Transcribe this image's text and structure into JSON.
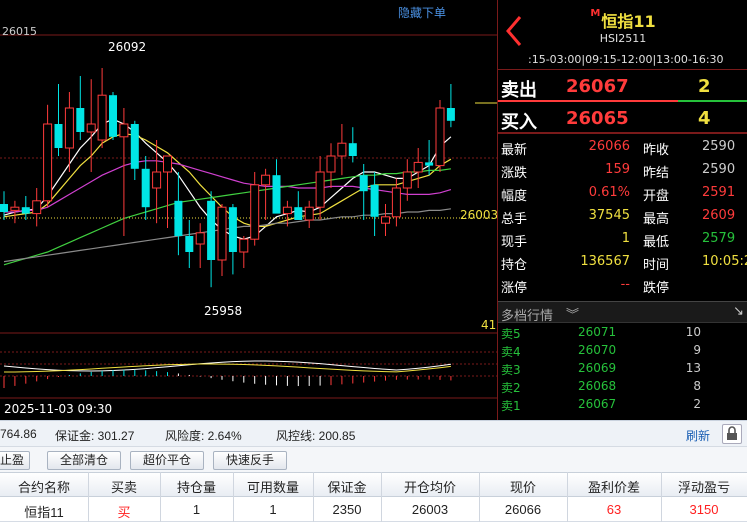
{
  "chart": {
    "hide_orders_label": "隐藏下单",
    "top_left_price": "26015",
    "high_label": "26092",
    "low_label": "25958",
    "current_price_tag": "26003",
    "volume_axis_value": "41",
    "date_label": "2025-11-03 09:30",
    "colors": {
      "up": "#ff3b3b",
      "down": "#00e5e5",
      "ma_white": "#ffffff",
      "ma_yellow": "#f0e040",
      "ma_purple": "#d040d0",
      "ma_green": "#40d040",
      "grid": "#7a1a1a"
    }
  },
  "chart_data": {
    "type": "candlestick",
    "y_range": [
      25940,
      26110
    ],
    "candles": [
      {
        "o": 26010,
        "h": 26018,
        "l": 26000,
        "c": 26005
      },
      {
        "o": 26006,
        "h": 26012,
        "l": 25998,
        "c": 26008
      },
      {
        "o": 26008,
        "h": 26015,
        "l": 26000,
        "c": 26004
      },
      {
        "o": 26004,
        "h": 26020,
        "l": 25996,
        "c": 26012
      },
      {
        "o": 26012,
        "h": 26072,
        "l": 26008,
        "c": 26060
      },
      {
        "o": 26060,
        "h": 26085,
        "l": 26040,
        "c": 26045
      },
      {
        "o": 26045,
        "h": 26080,
        "l": 26030,
        "c": 26070
      },
      {
        "o": 26070,
        "h": 26090,
        "l": 26050,
        "c": 26055
      },
      {
        "o": 26055,
        "h": 26088,
        "l": 26030,
        "c": 26060
      },
      {
        "o": 26050,
        "h": 26095,
        "l": 26045,
        "c": 26078
      },
      {
        "o": 26078,
        "h": 26080,
        "l": 26050,
        "c": 26052
      },
      {
        "o": 26052,
        "h": 26070,
        "l": 25990,
        "c": 26060
      },
      {
        "o": 26060,
        "h": 26062,
        "l": 26025,
        "c": 26032
      },
      {
        "o": 26032,
        "h": 26040,
        "l": 26000,
        "c": 26008
      },
      {
        "o": 26020,
        "h": 26050,
        "l": 25998,
        "c": 26030
      },
      {
        "o": 26030,
        "h": 26040,
        "l": 25995,
        "c": 26040
      },
      {
        "o": 26012,
        "h": 26030,
        "l": 25978,
        "c": 25990
      },
      {
        "o": 25990,
        "h": 26000,
        "l": 25970,
        "c": 25980
      },
      {
        "o": 25985,
        "h": 25998,
        "l": 25970,
        "c": 25992
      },
      {
        "o": 26012,
        "h": 26018,
        "l": 25958,
        "c": 25975
      },
      {
        "o": 25975,
        "h": 26010,
        "l": 25965,
        "c": 26008
      },
      {
        "o": 26008,
        "h": 26010,
        "l": 25966,
        "c": 25980
      },
      {
        "o": 25980,
        "h": 25990,
        "l": 25970,
        "c": 25988
      },
      {
        "o": 25988,
        "h": 26030,
        "l": 25984,
        "c": 26022
      },
      {
        "o": 26022,
        "h": 26032,
        "l": 26000,
        "c": 26028
      },
      {
        "o": 26028,
        "h": 26038,
        "l": 26018,
        "c": 26004
      },
      {
        "o": 26004,
        "h": 26012,
        "l": 25996,
        "c": 26008
      },
      {
        "o": 26008,
        "h": 26018,
        "l": 26002,
        "c": 26000
      },
      {
        "o": 26000,
        "h": 26012,
        "l": 25995,
        "c": 26008
      },
      {
        "o": 26008,
        "h": 26040,
        "l": 26000,
        "c": 26030
      },
      {
        "o": 26030,
        "h": 26048,
        "l": 26020,
        "c": 26040
      },
      {
        "o": 26040,
        "h": 26060,
        "l": 26028,
        "c": 26048
      },
      {
        "o": 26048,
        "h": 26058,
        "l": 26036,
        "c": 26040
      },
      {
        "o": 26028,
        "h": 26035,
        "l": 26000,
        "c": 26018
      },
      {
        "o": 26022,
        "h": 26030,
        "l": 25990,
        "c": 26002
      },
      {
        "o": 25998,
        "h": 26010,
        "l": 25990,
        "c": 26002
      },
      {
        "o": 26002,
        "h": 26026,
        "l": 25996,
        "c": 26020
      },
      {
        "o": 26020,
        "h": 26038,
        "l": 26012,
        "c": 26030
      },
      {
        "o": 26030,
        "h": 26045,
        "l": 26020,
        "c": 26036
      },
      {
        "o": 26036,
        "h": 26050,
        "l": 26028,
        "c": 26034
      },
      {
        "o": 26034,
        "h": 26075,
        "l": 26030,
        "c": 26070
      },
      {
        "o": 26070,
        "h": 26085,
        "l": 26058,
        "c": 26062
      }
    ],
    "ma_series": [
      {
        "color": "white",
        "values": [
          26003,
          26005,
          26006,
          26007,
          26015,
          26025,
          26035,
          26045,
          26052,
          26060,
          26063,
          26060,
          26055,
          26048,
          26042,
          26036,
          26028,
          26018,
          26008,
          26000,
          25994,
          25990,
          25988,
          25990,
          25996,
          26002,
          26004,
          26006,
          26005,
          26008,
          26014,
          26020,
          26026,
          26030,
          26030,
          26028,
          26026,
          26026,
          26030,
          26034,
          26046,
          26052
        ]
      },
      {
        "color": "yellow",
        "values": [
          26002,
          26003,
          26004,
          26005,
          26010,
          26018,
          26026,
          26034,
          26040,
          26048,
          26052,
          26054,
          26053,
          26050,
          26046,
          26042,
          26036,
          26030,
          26022,
          26015,
          26008,
          26002,
          25998,
          25996,
          25996,
          25998,
          26000,
          26002,
          26003,
          26004,
          26008,
          26012,
          26016,
          26020,
          26022,
          26022,
          26022,
          26024,
          26026,
          26028,
          26034,
          26038
        ]
      },
      {
        "color": "purple",
        "values": [
          26005,
          26005,
          26006,
          26006,
          26008,
          26012,
          26016,
          26020,
          26024,
          26028,
          26031,
          26034,
          26036,
          26037,
          26037,
          26036,
          26035,
          26033,
          26031,
          26029,
          26027,
          26025,
          26023,
          26022,
          26021,
          26021,
          26021,
          26020,
          26020,
          26020,
          26021,
          26021,
          26021,
          26020,
          26019,
          26018,
          26017,
          26016,
          26016,
          26016,
          26017,
          26019
        ]
      },
      {
        "color": "green",
        "values": [
          25972,
          25974,
          25976,
          25978,
          25980,
          25983,
          25986,
          25989,
          25992,
          25995,
          25998,
          26001,
          26003,
          26005,
          26007,
          26009,
          26011,
          26012,
          26013,
          26014,
          26015,
          26016,
          26017,
          26018,
          26019,
          26020,
          26021,
          26022,
          26023,
          26024,
          26025,
          26026,
          26027,
          26028,
          26028,
          26029,
          26029,
          26030,
          26030,
          26031,
          26031,
          26032
        ]
      },
      {
        "color": "gray",
        "values": [
          25974,
          25975,
          25976,
          25977,
          25978,
          25979,
          25980,
          25981,
          25982,
          25983,
          25984,
          25985,
          25986,
          25987,
          25988,
          25989,
          25990,
          25991,
          25992,
          25993,
          25994,
          25995,
          25996,
          25996,
          25997,
          25998,
          25998,
          25999,
          26000,
          26000,
          26001,
          26002,
          26002,
          26003,
          26003,
          26004,
          26004,
          26005,
          26005,
          26006,
          26006,
          26007
        ]
      }
    ]
  },
  "quote": {
    "title_prefix": "M",
    "title": "恒指11",
    "code": "HSI2511",
    "hours": ":15-03:00|09:15-12:00|13:00-16:30",
    "ask_label": "卖出",
    "ask_price": "26067",
    "ask_vol": "2",
    "bid_label": "买入",
    "bid_price": "26065",
    "bid_vol": "4",
    "rows": [
      {
        "l1": "最新",
        "v1": "26066",
        "c1": "#ff3b3b",
        "l2": "昨收",
        "v2": "2590",
        "c2": "#ccc"
      },
      {
        "l1": "涨跌",
        "v1": "159",
        "c1": "#ff3b3b",
        "l2": "昨结",
        "v2": "2590",
        "c2": "#ccc"
      },
      {
        "l1": "幅度",
        "v1": "0.61%",
        "c1": "#ff3b3b",
        "l2": "开盘",
        "v2": "2591",
        "c2": "#ff3b3b"
      },
      {
        "l1": "总手",
        "v1": "37545",
        "c1": "#f0e040",
        "l2": "最高",
        "v2": "2609",
        "c2": "#ff3b3b"
      },
      {
        "l1": "现手",
        "v1": "1",
        "c1": "#f0e040",
        "l2": "最低",
        "v2": "2579",
        "c2": "#26c13b"
      },
      {
        "l1": "持仓",
        "v1": "136567",
        "c1": "#f0e040",
        "l2": "时间",
        "v2": "10:05:2",
        "c2": "#f0e040"
      },
      {
        "l1": "涨停",
        "v1": "--",
        "c1": "#ff3b3b",
        "l2": "跌停",
        "v2": "",
        "c2": "#ccc"
      }
    ],
    "depth_title": "多档行情",
    "depth_chevron": "︾",
    "depth_arrow": "↘",
    "depth": [
      {
        "label": "卖5",
        "price": "26071",
        "vol": "10"
      },
      {
        "label": "卖4",
        "price": "26070",
        "vol": "9"
      },
      {
        "label": "卖3",
        "price": "26069",
        "vol": "13"
      },
      {
        "label": "卖2",
        "price": "26068",
        "vol": "8"
      },
      {
        "label": "卖1",
        "price": "26067",
        "vol": "2"
      }
    ]
  },
  "account": {
    "balance_fragment": "764.86",
    "margin": "保证金: 301.27",
    "risk": "风险度: 2.64%",
    "risk_line": "风控线: 200.85",
    "refresh": "刷新"
  },
  "toolbar": {
    "tab_partial": "止盈",
    "close_all": "全部清仓",
    "market_close": "超价平仓",
    "quick_reverse": "快速反手"
  },
  "positions": {
    "headers": [
      "合约名称",
      "买卖",
      "持仓量",
      "可用数量",
      "保证金",
      "开仓均价",
      "现价",
      "盈利价差",
      "浮动盈亏"
    ],
    "rows": [
      [
        "恒指11",
        "买",
        "1",
        "1",
        "2350",
        "26003",
        "26066",
        "63",
        "3150"
      ]
    ]
  }
}
